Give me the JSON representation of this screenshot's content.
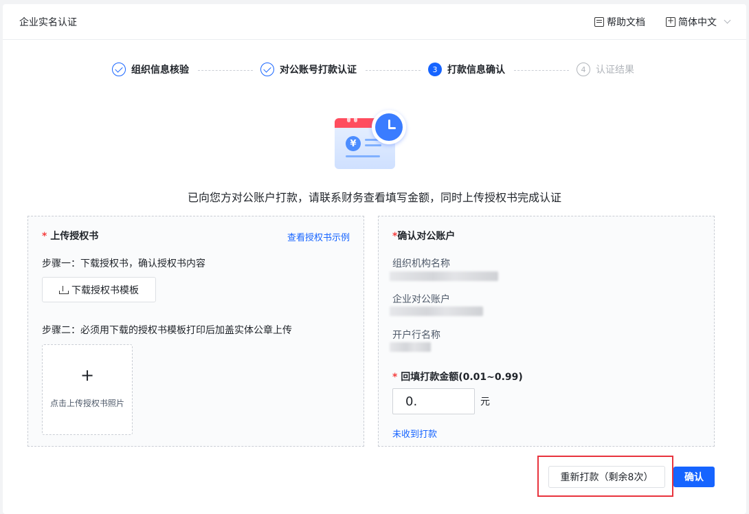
{
  "header": {
    "title": "企业实名认证",
    "help_docs": "帮助文档",
    "language": "简体中文"
  },
  "steps": [
    {
      "label": "组织信息核验",
      "status": "done"
    },
    {
      "label": "对公账号打款认证",
      "status": "done"
    },
    {
      "label": "打款信息确认",
      "status": "active",
      "number": "3"
    },
    {
      "label": "认证结果",
      "status": "todo",
      "number": "4"
    }
  ],
  "illustration": {
    "currency_symbol": "¥"
  },
  "notice": "已向您方对公账户打款，请联系财务查看填写金额，同时上传授权书完成认证",
  "upload_card": {
    "required_mark": "*",
    "title": "上传授权书",
    "example_link": "查看授权书示例",
    "step1": "步骤一：下载授权书，确认授权书内容",
    "download_button": "下载授权书模板",
    "step2": "步骤二：必须用下载的授权书模板打印后加盖实体公章上传",
    "upload_plus": "+",
    "upload_label": "点击上传授权书照片"
  },
  "confirm_card": {
    "required_mark": "*",
    "title": "确认对公账户",
    "org_name_label": "组织机构名称",
    "account_label": "企业对公账户",
    "bank_label": "开户行名称",
    "amount_label": "回填打款金额(0.01~0.99)",
    "amount_value": "0.",
    "unit": "元",
    "not_received_link": "未收到打款"
  },
  "footer": {
    "retry_button": "重新打款（剩余8次）",
    "confirm_button": "确认"
  },
  "colors": {
    "primary": "#1664ff",
    "required": "#f53f3f",
    "highlight": "#e8323c"
  }
}
